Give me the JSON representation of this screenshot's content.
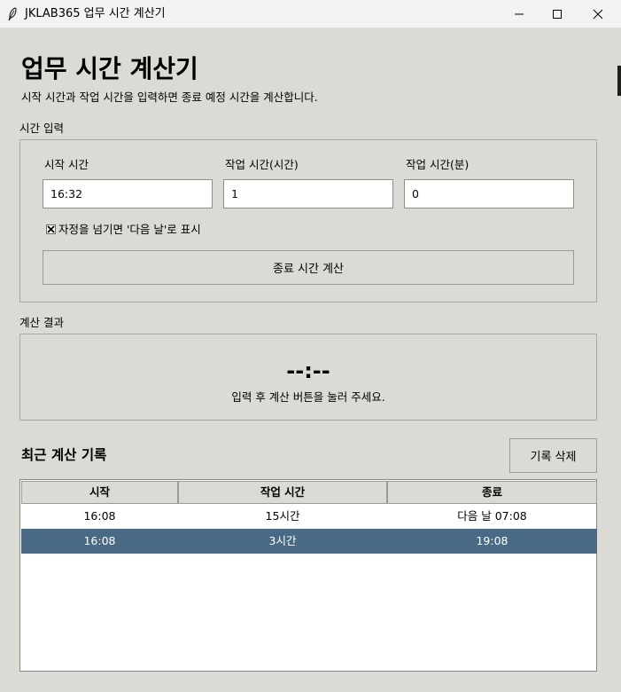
{
  "window": {
    "title": "JKLAB365 업무 시간 계산기"
  },
  "header": {
    "title": "업무 시간 계산기",
    "subtitle": "시작 시간과 작업 시간을 입력하면 종료 예정 시간을 계산합니다."
  },
  "input_section": {
    "label": "시간 입력",
    "start_label": "시작 시간",
    "start_value": "16:32",
    "hours_label": "작업 시간(시간)",
    "hours_value": "1",
    "minutes_label": "작업 시간(분)",
    "minutes_value": "0",
    "next_day_label": "자정을 넘기면 '다음 날'로 표시",
    "next_day_checked": true,
    "calc_button": "종료 시간 계산"
  },
  "result_section": {
    "label": "계산 결과",
    "time": "--:--",
    "message": "입력 후 계산 버튼을 눌러 주세요."
  },
  "history": {
    "title": "최근 계산 기록",
    "delete_button": "기록 삭제",
    "columns": [
      "시작",
      "작업 시간",
      "종료"
    ],
    "rows": [
      {
        "start": "16:08",
        "duration": "15시간",
        "end": "다음 날 07:08",
        "selected": false
      },
      {
        "start": "16:08",
        "duration": "3시간",
        "end": "19:08",
        "selected": true
      }
    ]
  },
  "colors": {
    "background": "#dcdad5",
    "selection": "#4a6984"
  }
}
